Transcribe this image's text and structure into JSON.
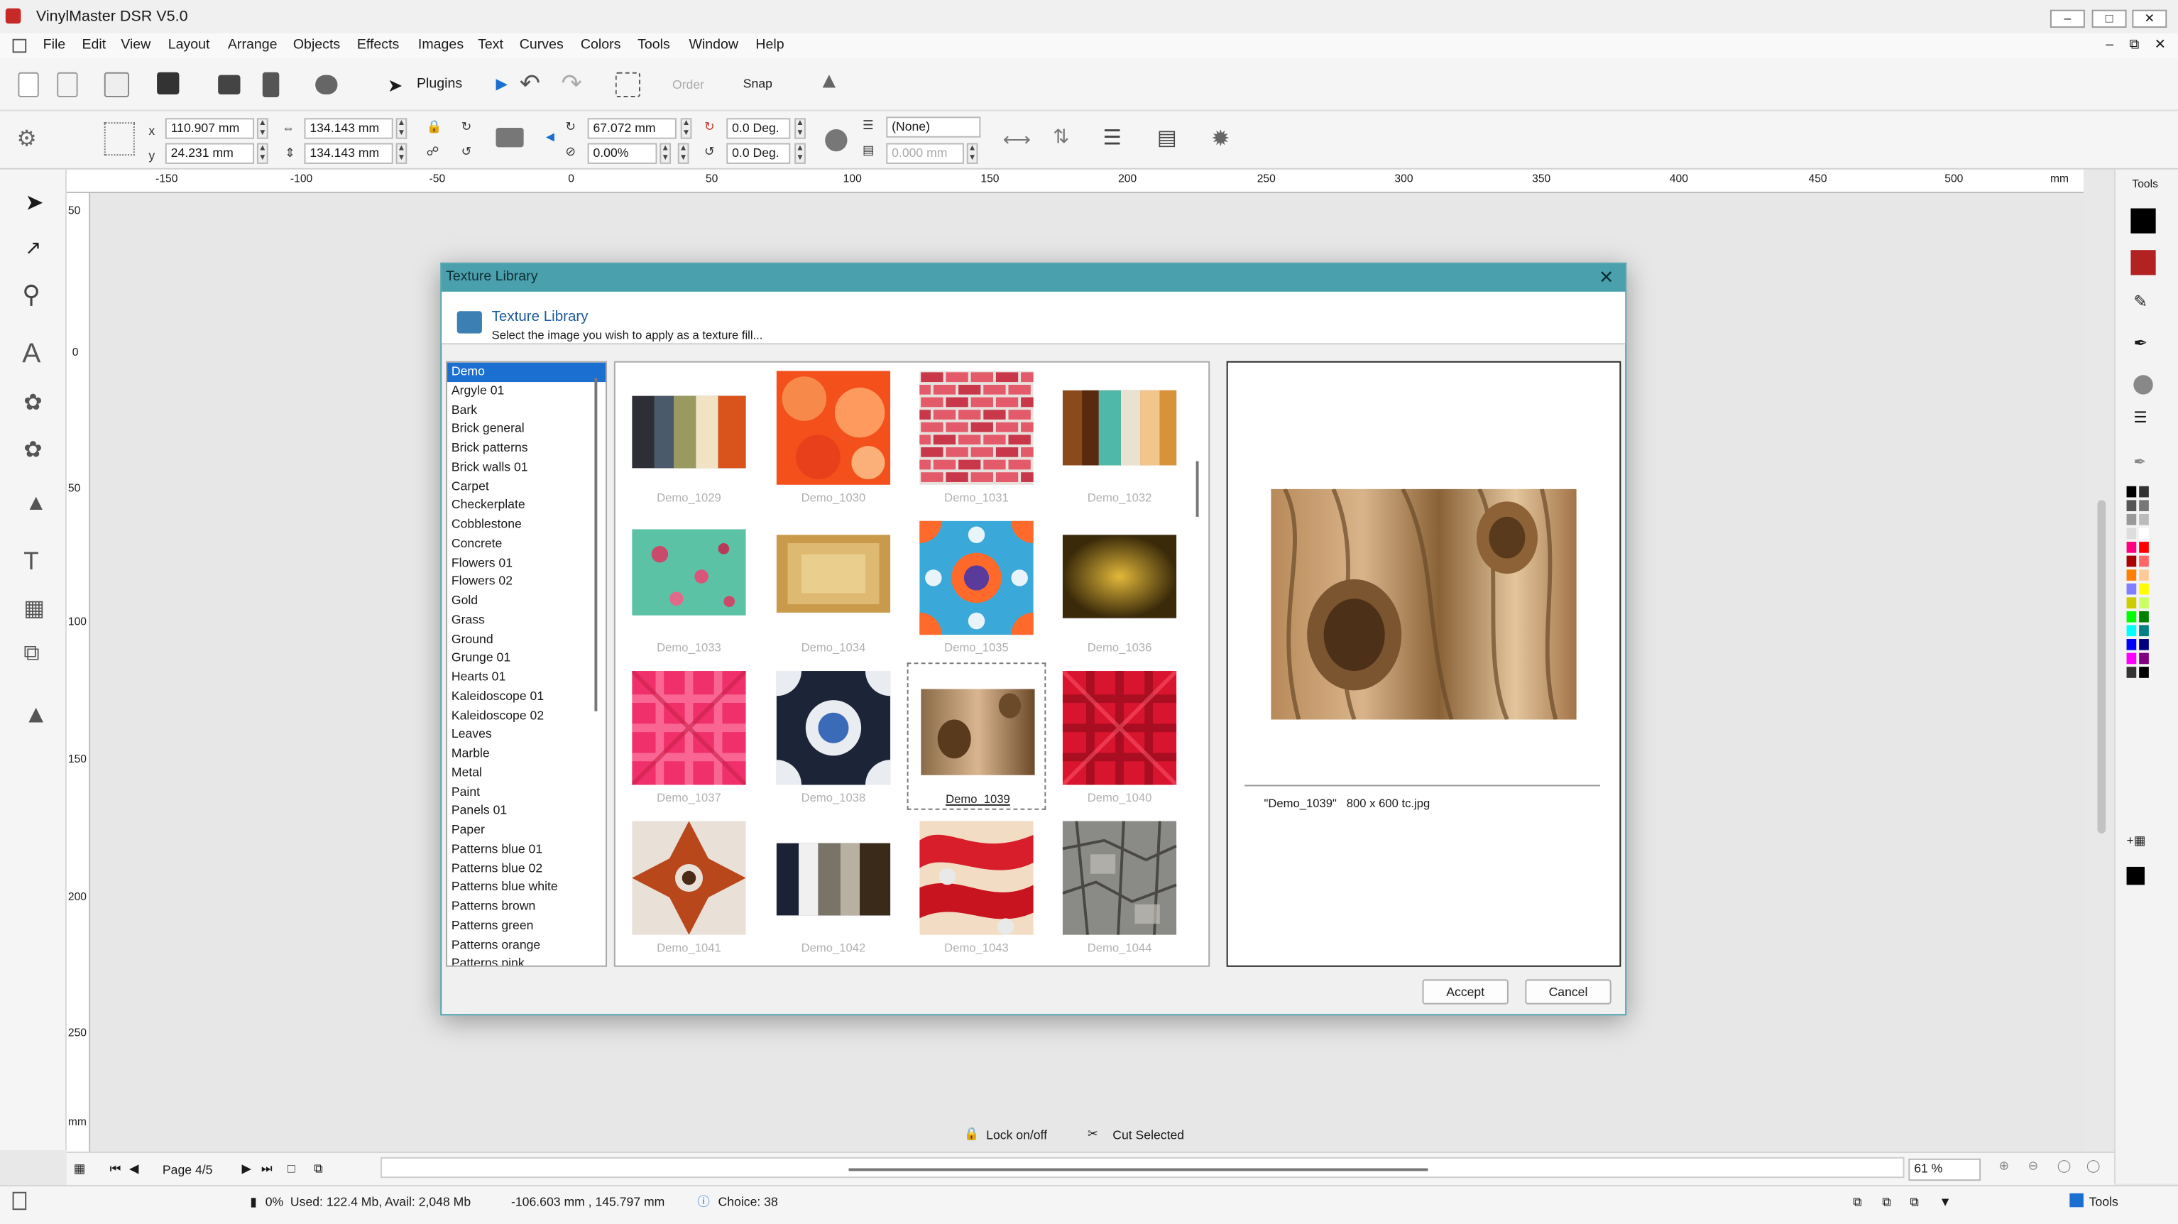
{
  "app": {
    "title": "VinylMaster DSR V5.0"
  },
  "menu": [
    "File",
    "Edit",
    "View",
    "Layout",
    "Arrange",
    "Objects",
    "Effects",
    "Images",
    "Text",
    "Curves",
    "Colors",
    "Tools",
    "Window",
    "Help"
  ],
  "toolbar": {
    "plugins_label": "Plugins",
    "order_label": "Order",
    "snap_label": "Snap"
  },
  "props": {
    "x_label": "x",
    "y_label": "y",
    "x_value": "110.907 mm",
    "y_value": "24.231 mm",
    "w_value": "134.143 mm",
    "h_value": "134.143 mm",
    "rot_value": "67.072 mm",
    "pct_value": "0.00%",
    "deg1_value": "0.0 Deg.",
    "deg2_value": "0.0 Deg.",
    "line_style": "(None)",
    "line_width": "0.000 mm"
  },
  "ruler": {
    "h_ticks": [
      "-150",
      "-100",
      "-50",
      "0",
      "50",
      "100",
      "150",
      "200",
      "250",
      "300",
      "350",
      "400",
      "450",
      "500"
    ],
    "h_unit": "mm",
    "v_ticks": [
      "50",
      "0",
      "50",
      "100",
      "150",
      "200",
      "250"
    ],
    "v_unit": "mm"
  },
  "dialog": {
    "title": "Texture Library",
    "heading": "Texture Library",
    "subheading": "Select the image you wish to apply as a texture fill...",
    "categories": [
      "Demo",
      "Argyle 01",
      "Bark",
      "Brick general",
      "Brick patterns",
      "Brick walls 01",
      "Carpet",
      "Checkerplate",
      "Cobblestone",
      "Concrete",
      "Flowers 01",
      "Flowers 02",
      "Gold",
      "Grass",
      "Ground",
      "Grunge 01",
      "Hearts 01",
      "Kaleidoscope 01",
      "Kaleidoscope 02",
      "Leaves",
      "Marble",
      "Metal",
      "Paint",
      "Panels 01",
      "Paper",
      "Patterns blue 01",
      "Patterns blue 02",
      "Patterns blue white",
      "Patterns brown",
      "Patterns green",
      "Patterns orange",
      "Patterns pink"
    ],
    "selected_category": "Demo",
    "textures": [
      {
        "name": "Demo_1029",
        "icon": "stripes-texture"
      },
      {
        "name": "Demo_1030",
        "icon": "hearts-orange-texture"
      },
      {
        "name": "Demo_1031",
        "icon": "brick-wall-texture"
      },
      {
        "name": "Demo_1032",
        "icon": "stripes-texture"
      },
      {
        "name": "Demo_1033",
        "icon": "floral-teal-texture"
      },
      {
        "name": "Demo_1034",
        "icon": "parchment-texture"
      },
      {
        "name": "Demo_1035",
        "icon": "kaleidoscope-texture"
      },
      {
        "name": "Demo_1036",
        "icon": "gold-gradient-texture"
      },
      {
        "name": "Demo_1037",
        "icon": "plaid-pink-texture"
      },
      {
        "name": "Demo_1038",
        "icon": "kaleidoscope-navy-texture"
      },
      {
        "name": "Demo_1039",
        "icon": "wood-knot-texture"
      },
      {
        "name": "Demo_1040",
        "icon": "plaid-red-texture"
      },
      {
        "name": "Demo_1041",
        "icon": "kaleidoscope-rust-texture"
      },
      {
        "name": "Demo_1042",
        "icon": "stripes-gray-texture"
      },
      {
        "name": "Demo_1043",
        "icon": "hearts-red-texture"
      },
      {
        "name": "Demo_1044",
        "icon": "bark-gray-texture"
      }
    ],
    "selected_texture": "Demo_1039",
    "preview_info": "\"Demo_1039\"   800 x 600 tc.jpg",
    "accept_label": "Accept",
    "cancel_label": "Cancel"
  },
  "bottom": {
    "lock_label": "Lock on/off",
    "cut_label": "Cut Selected",
    "page_label": "Page 4/5",
    "zoom": "61 %",
    "status_mem_pct": "0%",
    "status_mem": "Used: 122.4 Mb, Avail: 2,048 Mb",
    "status_coords": "-106.603 mm , 145.797 mm",
    "status_choice": "Choice: 38",
    "tools_label": "Tools"
  },
  "right_panel": {
    "tools_label": "Tools"
  },
  "palette": [
    "#000000",
    "#333333",
    "#555555",
    "#777777",
    "#999999",
    "#bbbbbb",
    "#dddddd",
    "#ffffff",
    "#ff0080",
    "#ff0000",
    "#aa0000",
    "#ff6666",
    "#ff8000",
    "#ffcc99",
    "#8080ff",
    "#ffff00",
    "#cccc00",
    "#ccff66",
    "#00ff00",
    "#008000",
    "#00ffff",
    "#008080",
    "#0000ff",
    "#000080",
    "#ff00ff",
    "#800080",
    "#333333",
    "#000000"
  ]
}
